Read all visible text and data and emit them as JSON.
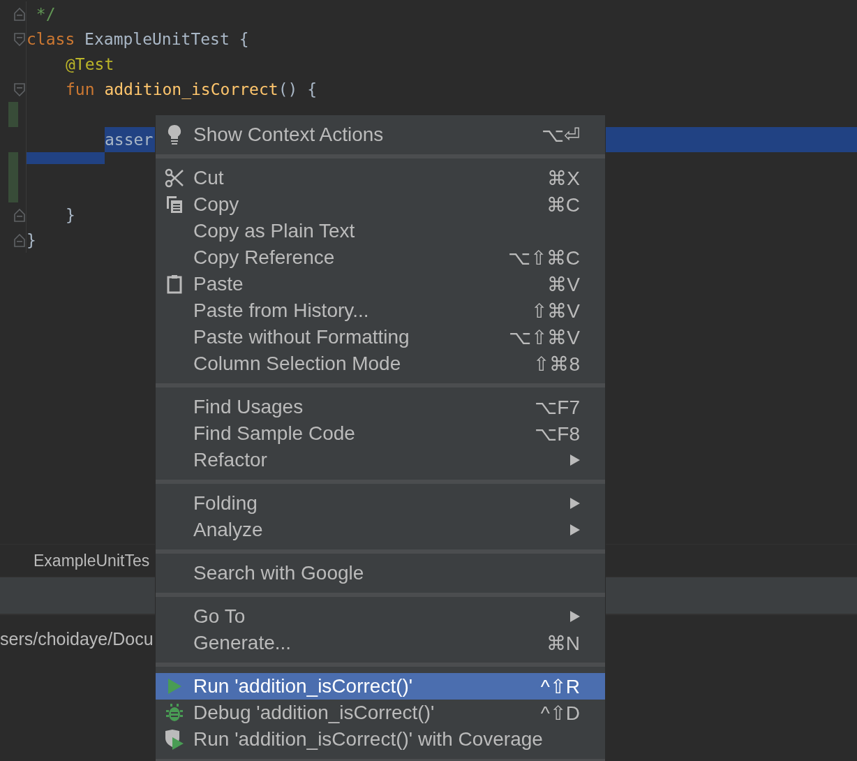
{
  "editor": {
    "lines": [
      {
        "tokens": [
          {
            "text": " */",
            "kind": "comment"
          }
        ],
        "fold_marker": true,
        "changed": false,
        "selected": false
      },
      {
        "tokens": [
          {
            "text": "class",
            "kind": "keyword"
          },
          {
            "text": " ExampleUnitTest {",
            "kind": "plain"
          }
        ],
        "fold_marker": true,
        "changed": false,
        "selected": false,
        "children": [
          {
            "tokens": [
              {
                "text": "@Test",
                "kind": "annotation"
              }
            ],
            "fold_marker": false,
            "changed": false,
            "selected": false
          },
          {
            "tokens": [
              {
                "text": "fun",
                "kind": "keyword"
              },
              {
                "text": " addition_isCorrect",
                "kind": "function"
              },
              {
                "text": "() {",
                "kind": "plain"
              }
            ],
            "fold_marker": true,
            "changed": false,
            "selected": false,
            "children": [
              {
                "fold_marker": false,
                "changed": true,
                "selected": false
              },
              {
                "tokens": [
                  {
                    "text": "asser",
                    "kind": "plain"
                  }
                ],
                "fold_marker": false,
                "changed": false,
                "selected": true
              },
              {
                "fold_marker": false,
                "changed": true,
                "selected": true
              },
              {
                "fold_marker": false,
                "changed": true,
                "selected": false
              }
            ]
          },
          {
            "tokens": [
              {
                "text": "}",
                "kind": "plain"
              }
            ],
            "fold_marker": true,
            "changed": false,
            "selected": false
          }
        ]
      },
      {
        "tokens": [
          {
            "text": "}",
            "kind": "plain"
          }
        ],
        "fold_marker": true,
        "changed": false,
        "selected": false
      }
    ]
  },
  "bottom_panel": {
    "tab": "ExampleUnitTes",
    "console_text": "sers/choidaye/Docu"
  },
  "context_menu": {
    "groups": [
      [
        {
          "kind": "hint",
          "label": "Show Context Actions",
          "shortcut": "⌥⏎",
          "submenu": false,
          "selected": false
        }
      ],
      [
        {
          "kind": "cut",
          "label": "Cut",
          "shortcut": "⌘X",
          "submenu": false,
          "selected": false
        },
        {
          "kind": "copy",
          "label": "Copy",
          "shortcut": "⌘C",
          "submenu": false,
          "selected": false
        },
        {
          "kind": "plain",
          "label": "Copy as Plain Text",
          "submenu": false,
          "selected": false
        },
        {
          "kind": "plain",
          "label": "Copy Reference",
          "shortcut": "⌥⇧⌘C",
          "submenu": false,
          "selected": false
        },
        {
          "kind": "paste",
          "label": "Paste",
          "shortcut": "⌘V",
          "submenu": false,
          "selected": false
        },
        {
          "kind": "plain",
          "label": "Paste from History...",
          "shortcut": "⇧⌘V",
          "submenu": false,
          "selected": false
        },
        {
          "kind": "plain",
          "label": "Paste without Formatting",
          "shortcut": "⌥⇧⌘V",
          "submenu": false,
          "selected": false
        },
        {
          "kind": "plain",
          "label": "Column Selection Mode",
          "shortcut": "⇧⌘8",
          "submenu": false,
          "selected": false
        }
      ],
      [
        {
          "kind": "plain",
          "label": "Find Usages",
          "shortcut": "⌥F7",
          "submenu": false,
          "selected": false
        },
        {
          "kind": "plain",
          "label": "Find Sample Code",
          "shortcut": "⌥F8",
          "submenu": false,
          "selected": false
        },
        {
          "kind": "plain",
          "label": "Refactor",
          "submenu": true,
          "selected": false
        }
      ],
      [
        {
          "kind": "plain",
          "label": "Folding",
          "submenu": true,
          "selected": false
        },
        {
          "kind": "plain",
          "label": "Analyze",
          "submenu": true,
          "selected": false
        }
      ],
      [
        {
          "kind": "plain",
          "label": "Search with Google",
          "submenu": false,
          "selected": false
        }
      ],
      [
        {
          "kind": "plain",
          "label": "Go To",
          "submenu": true,
          "selected": false
        },
        {
          "kind": "plain",
          "label": "Generate...",
          "shortcut": "⌘N",
          "submenu": false,
          "selected": false
        }
      ],
      [
        {
          "kind": "run",
          "label": "Run 'addition_isCorrect()'",
          "shortcut": "^⇧R",
          "submenu": false,
          "selected": true
        },
        {
          "kind": "debug",
          "label": "Debug 'addition_isCorrect()'",
          "shortcut": "^⇧D",
          "submenu": false,
          "selected": false
        },
        {
          "kind": "coverage",
          "label": "Run 'addition_isCorrect()' with Coverage",
          "submenu": false,
          "selected": false
        }
      ]
    ]
  }
}
